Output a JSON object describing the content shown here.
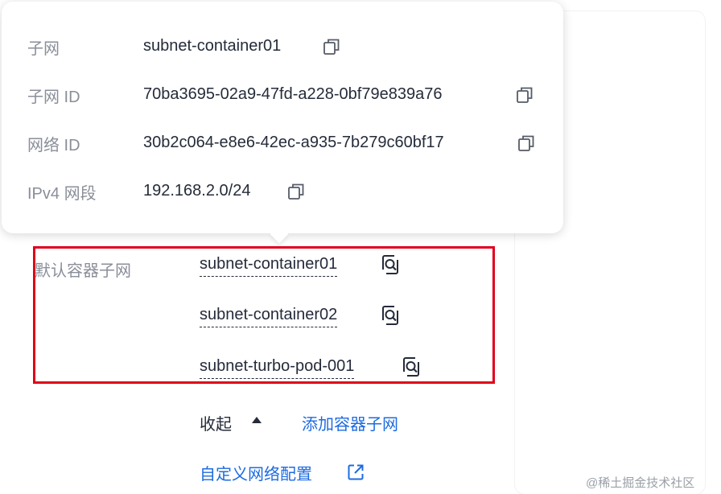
{
  "popover": {
    "rows": [
      {
        "label": "子网",
        "value": "subnet-container01"
      },
      {
        "label": "子网 ID",
        "value": "70ba3695-02a9-47fd-a228-0bf79e839a76"
      },
      {
        "label": "网络 ID",
        "value": "30b2c064-e8e6-42ec-a935-7b279c60bf17"
      },
      {
        "label": "IPv4 网段",
        "value": "192.168.2.0/24"
      }
    ],
    "copy_icon": "copy-icon"
  },
  "default_subnet": {
    "label": "默认容器子网",
    "items": [
      "subnet-container01",
      "subnet-container02",
      "subnet-turbo-pod-001"
    ],
    "item_icon": "search-icon",
    "highlight_color": "#e0001b"
  },
  "actions": {
    "collapse_label": "收起",
    "collapse_icon": "caret-up-icon",
    "add_label": "添加容器子网",
    "custom_network_label": "自定义网络配置",
    "custom_network_icon": "external-link-icon",
    "link_color": "#1e6be0"
  },
  "watermark": "@稀土掘金技术社区"
}
